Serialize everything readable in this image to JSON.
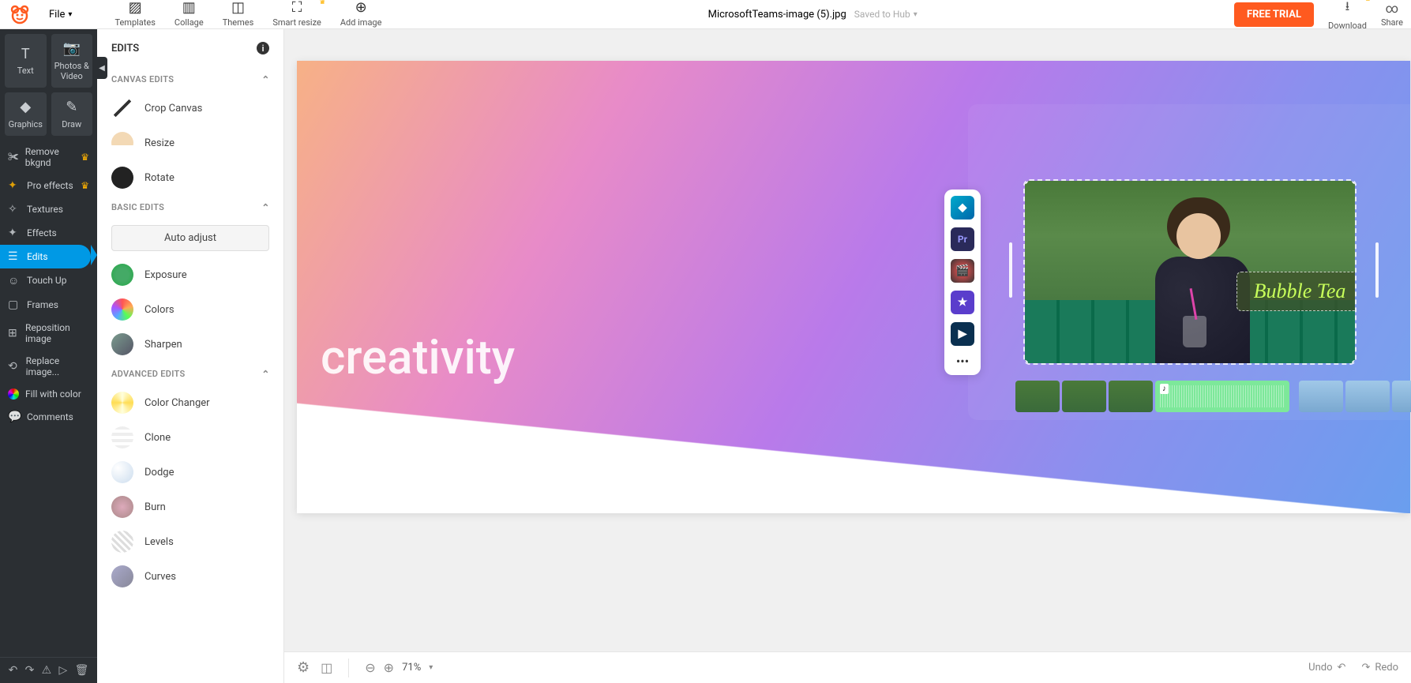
{
  "topbar": {
    "file_menu": "File",
    "tools": {
      "templates": "Templates",
      "collage": "Collage",
      "themes": "Themes",
      "smart_resize": "Smart resize",
      "add_image": "Add image"
    },
    "document_name": "MicrosoftTeams-image (5).jpg",
    "saved_hint": "Saved to Hub",
    "free_trial": "FREE TRIAL",
    "download": "Download",
    "share": "Share"
  },
  "left_rail": {
    "cards": {
      "text": "Text",
      "photos_video": "Photos & Video",
      "graphics": "Graphics",
      "draw": "Draw"
    },
    "items": {
      "remove_bkgnd": "Remove bkgnd",
      "pro_effects": "Pro effects",
      "textures": "Textures",
      "effects": "Effects",
      "edits": "Edits",
      "touch_up": "Touch Up",
      "frames": "Frames",
      "reposition_image": "Reposition image",
      "replace_image": "Replace image...",
      "fill_with_color": "Fill with color",
      "comments": "Comments"
    }
  },
  "panel": {
    "title": "EDITS",
    "sections": {
      "canvas_edits": "CANVAS EDITS",
      "basic_edits": "BASIC EDITS",
      "advanced_edits": "ADVANCED EDITS"
    },
    "items": {
      "crop_canvas": "Crop Canvas",
      "resize": "Resize",
      "rotate": "Rotate",
      "auto_adjust": "Auto adjust",
      "exposure": "Exposure",
      "colors": "Colors",
      "sharpen": "Sharpen",
      "color_changer": "Color Changer",
      "clone": "Clone",
      "dodge": "Dodge",
      "burn": "Burn",
      "levels": "Levels",
      "curves": "Curves"
    }
  },
  "canvas": {
    "word": "creativity",
    "bubble_label": "Bubble Tea",
    "dock": {
      "pr": "Pr",
      "more": "•••"
    }
  },
  "bottombar": {
    "zoom": "71%",
    "undo": "Undo",
    "redo": "Redo"
  }
}
